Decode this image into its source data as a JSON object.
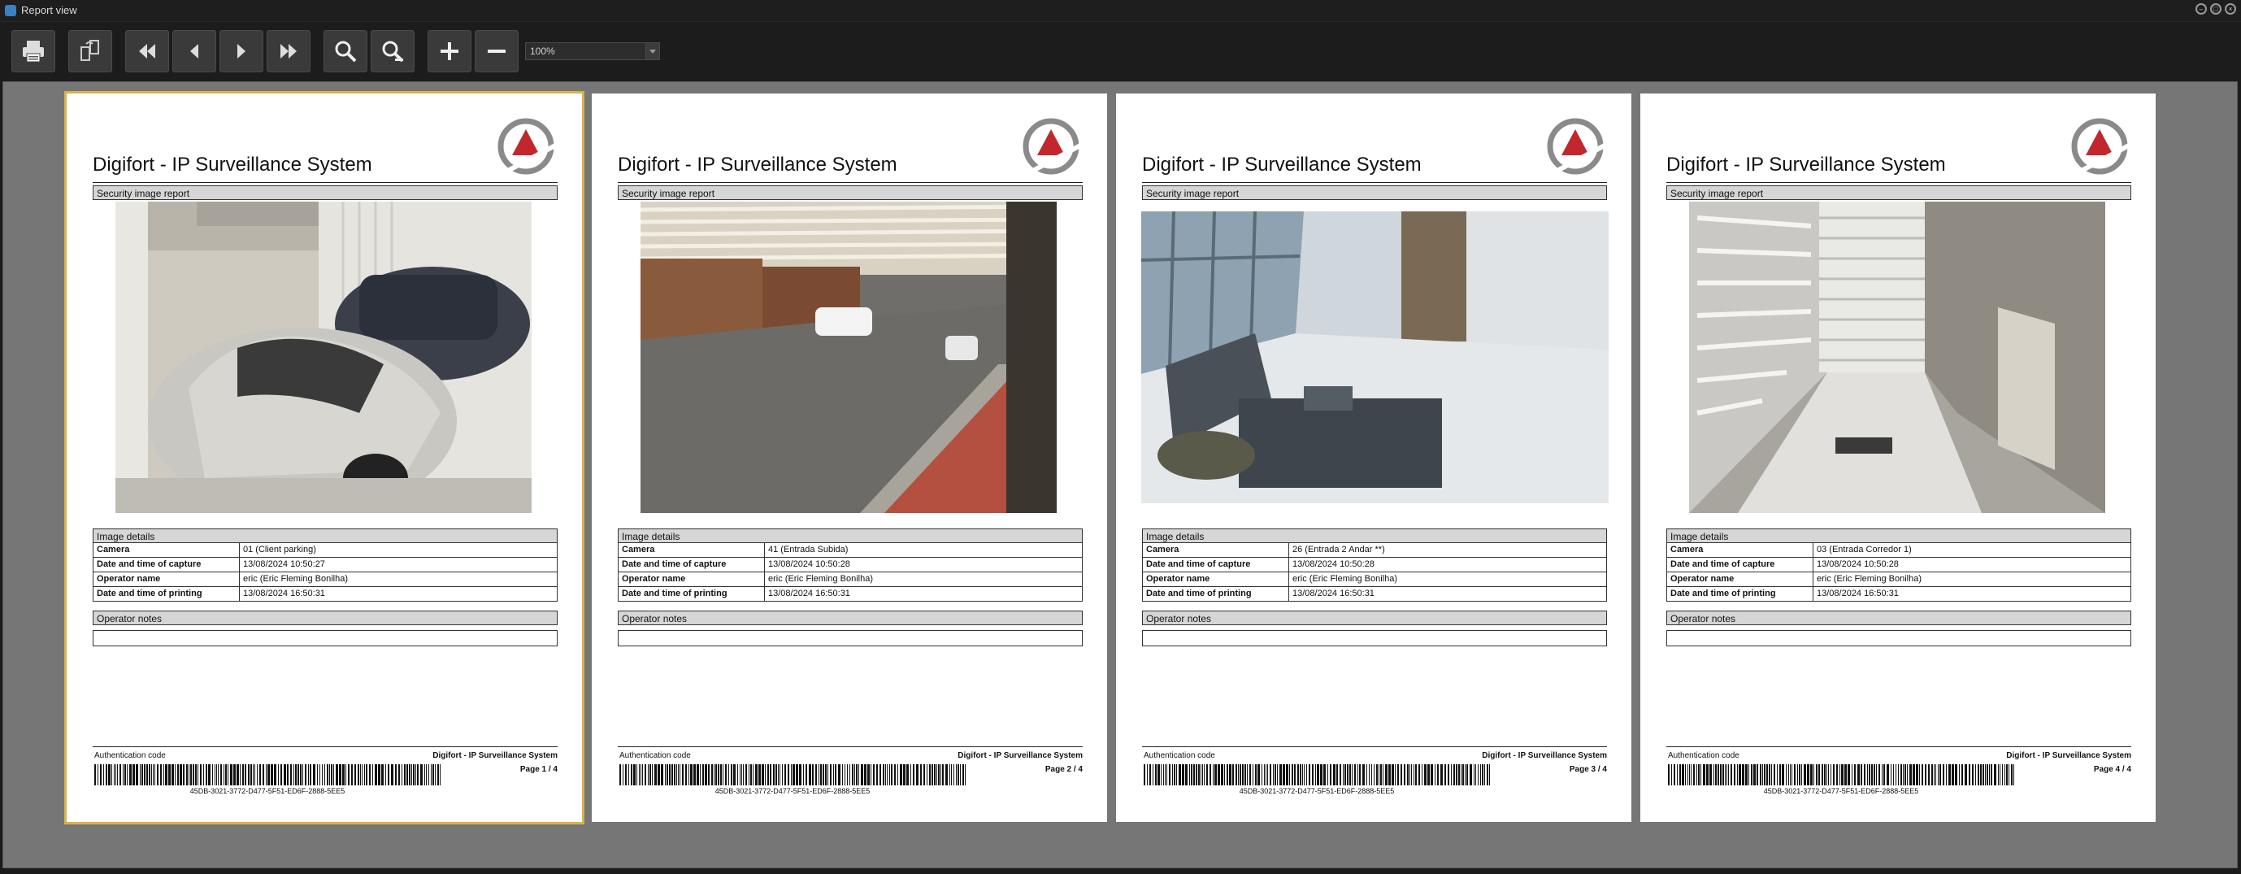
{
  "window": {
    "title": "Report view"
  },
  "toolbar": {
    "buttons": [
      {
        "name": "print-button",
        "icon": "printer-icon"
      },
      {
        "name": "page-setup-button",
        "icon": "page-setup-icon"
      },
      {
        "name": "first-page-button",
        "icon": "skip-first-icon"
      },
      {
        "name": "prev-page-button",
        "icon": "prev-icon"
      },
      {
        "name": "next-page-button",
        "icon": "next-icon"
      },
      {
        "name": "last-page-button",
        "icon": "skip-last-icon"
      },
      {
        "name": "zoom-in-button",
        "icon": "magnifier-plus-icon"
      },
      {
        "name": "zoom-out-button",
        "icon": "magnifier-minus-icon"
      },
      {
        "name": "add-button",
        "icon": "plus-icon"
      },
      {
        "name": "remove-button",
        "icon": "minus-icon"
      }
    ],
    "zoom_value": "100%"
  },
  "report": {
    "system_title": "Digifort - IP Surveillance System",
    "section_title": "Security image report",
    "details_header": "Image details",
    "notes_header": "Operator notes",
    "labels": {
      "camera": "Camera",
      "capture": "Date and time of capture",
      "operator": "Operator name",
      "printing": "Date and time of printing"
    },
    "auth_label": "Authentication code",
    "footer_system": "Digifort - IP Surveillance System",
    "auth_code": "45DB-3021-3772-D477-5F51-ED6F-2888-5EE5"
  },
  "pages": [
    {
      "camera": "01 (Client parking)",
      "capture": "13/08/2024 10:50:27",
      "operator": "eric (Eric Fleming Bonilha)",
      "printing": "13/08/2024 16:50:31",
      "page": "Page 1 / 4",
      "scene": "garage"
    },
    {
      "camera": "41 (Entrada Subida)",
      "capture": "13/08/2024 10:50:28",
      "operator": "eric (Eric Fleming Bonilha)",
      "printing": "13/08/2024 16:50:31",
      "page": "Page 2 / 4",
      "scene": "street"
    },
    {
      "camera": "26 (Entrada 2 Andar **)",
      "capture": "13/08/2024 10:50:28",
      "operator": "eric (Eric Fleming Bonilha)",
      "printing": "13/08/2024 16:50:31",
      "page": "Page 3 / 4",
      "scene": "lobby"
    },
    {
      "camera": "03 (Entrada Corredor 1)",
      "capture": "13/08/2024 10:50:28",
      "operator": "eric (Eric Fleming Bonilha)",
      "printing": "13/08/2024 16:50:31",
      "page": "Page 4 / 4",
      "scene": "corridor"
    }
  ]
}
